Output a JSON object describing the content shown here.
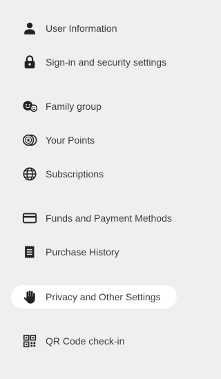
{
  "menu": {
    "items": [
      {
        "label": "User Information",
        "icon": "user-icon"
      },
      {
        "label": "Sign-in and security settings",
        "icon": "lock-icon"
      },
      {
        "label": "Family group",
        "icon": "family-icon"
      },
      {
        "label": "Your Points",
        "icon": "points-icon"
      },
      {
        "label": "Subscriptions",
        "icon": "globe-icon"
      },
      {
        "label": "Funds and Payment Methods",
        "icon": "credit-card-icon"
      },
      {
        "label": "Purchase History",
        "icon": "receipt-icon"
      },
      {
        "label": "Privacy and Other Settings",
        "icon": "hand-icon",
        "selected": true
      },
      {
        "label": "QR Code check-in",
        "icon": "qr-code-icon"
      }
    ]
  },
  "colors": {
    "background": "#efefef",
    "selected_background": "#ffffff",
    "text": "#3c3c3c",
    "icon": "#222222"
  }
}
